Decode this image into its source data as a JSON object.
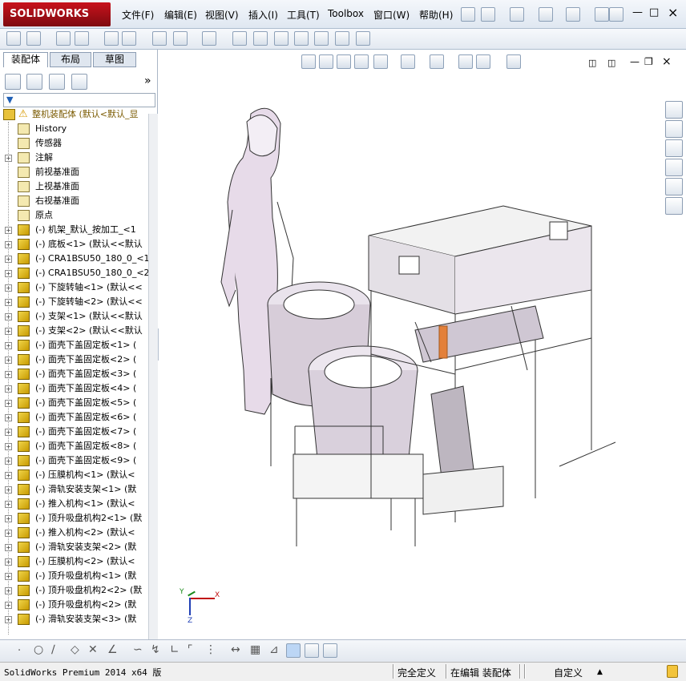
{
  "app": {
    "logo": "SOLIDWORKS",
    "brand": "#c8121c"
  },
  "menu": [
    "文件(F)",
    "编辑(E)",
    "视图(V)",
    "插入(I)",
    "工具(T)",
    "Toolbox",
    "窗口(W)",
    "帮助(H)"
  ],
  "panel": {
    "tabs": [
      "装配体",
      "布局",
      "草图"
    ],
    "expand": "»"
  },
  "tree": {
    "root": "整机装配体  (默认<默认_显",
    "fixed": [
      {
        "name": "history-item",
        "label": "History"
      },
      {
        "name": "sensors-item",
        "label": "传感器"
      },
      {
        "name": "annotations-item",
        "label": "注解"
      },
      {
        "name": "front-plane-item",
        "label": "前视基准面"
      },
      {
        "name": "top-plane-item",
        "label": "上视基准面"
      },
      {
        "name": "right-plane-item",
        "label": "右视基准面"
      },
      {
        "name": "origin-item",
        "label": "原点"
      }
    ],
    "components": [
      "(-) 机架_默认_按加工_<1",
      "(-) 底板<1> (默认<<默认",
      "(-) CRA1BSU50_180_0_<1>",
      "(-) CRA1BSU50_180_0_<2>",
      "(-) 下旋转轴<1> (默认<<",
      "(-) 下旋转轴<2> (默认<<",
      "(-) 支架<1> (默认<<默认",
      "(-) 支架<2> (默认<<默认",
      "(-) 面壳下盖固定板<1> (",
      "(-) 面壳下盖固定板<2> (",
      "(-) 面壳下盖固定板<3> (",
      "(-) 面壳下盖固定板<4> (",
      "(-) 面壳下盖固定板<5> (",
      "(-) 面壳下盖固定板<6> (",
      "(-) 面壳下盖固定板<7> (",
      "(-) 面壳下盖固定板<8> (",
      "(-) 面壳下盖固定板<9> (",
      "(-) 压膜机构<1> (默认<",
      "(-) 滑轨安装支架<1> (默",
      "(-) 推入机构<1> (默认<",
      "(-) 顶升吸盘机构2<1> (默",
      "(-) 推入机构<2> (默认<",
      "(-) 滑轨安装支架<2> (默",
      "(-) 压膜机构<2> (默认<",
      "(-) 顶升吸盘机构<1> (默",
      "(-) 顶升吸盘机构2<2> (默",
      "(-) 顶升吸盘机构<2> (默",
      "(-) 滑轨安装支架<3> (默"
    ]
  },
  "triad": {
    "x": "X",
    "y": "Y",
    "z": "Z"
  },
  "status": {
    "product": "SolidWorks Premium 2014 x64 版",
    "defined": "完全定义",
    "editing": "在编辑 装配体",
    "custom": "自定义"
  }
}
